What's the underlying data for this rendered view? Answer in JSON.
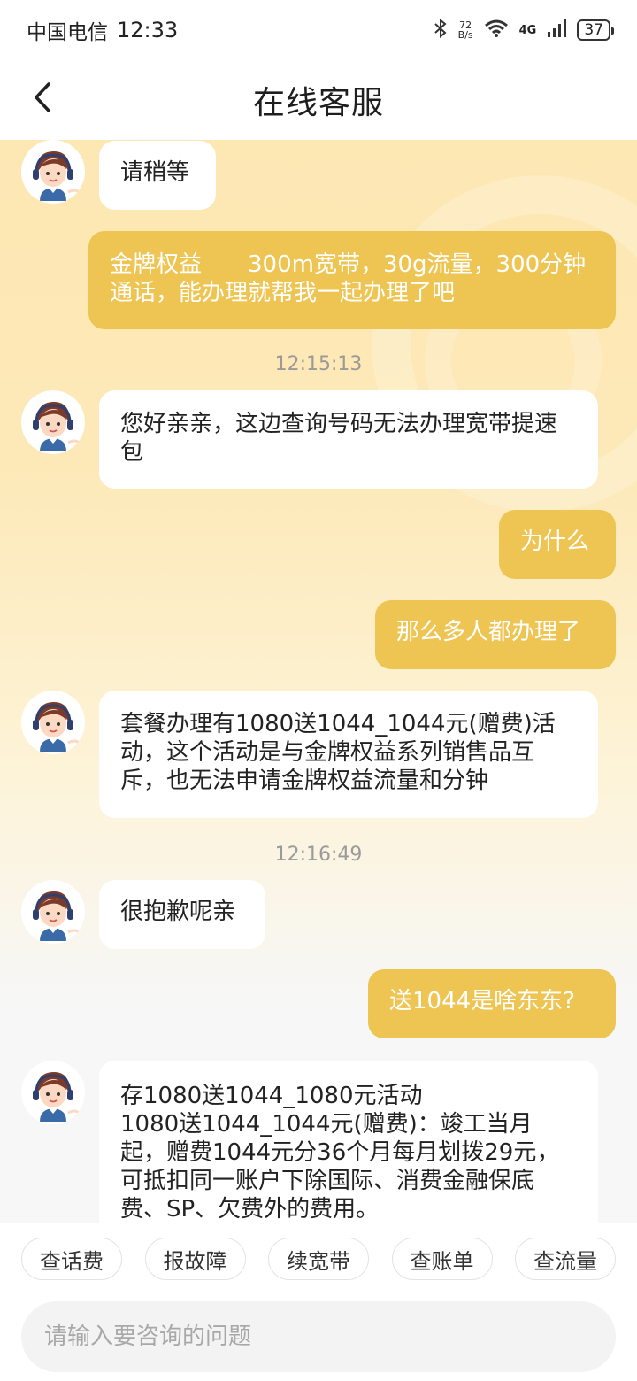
{
  "status_bar": {
    "carrier": "中国电信",
    "time": "12:33",
    "net_speed_value": "72",
    "net_speed_unit": "B/s",
    "network": "4G",
    "battery": "37"
  },
  "header": {
    "title": "在线客服"
  },
  "messages": [
    {
      "role": "agent",
      "text": "请稍等"
    },
    {
      "role": "user",
      "text": "金牌权益　　300m宽带，30g流量，300分钟通话，能办理就帮我一起办理了吧"
    },
    {
      "role": "time",
      "text": "12:15:13"
    },
    {
      "role": "agent",
      "text": "您好亲亲，这边查询号码无法办理宽带提速包"
    },
    {
      "role": "user",
      "text": "为什么"
    },
    {
      "role": "user",
      "text": "那么多人都办理了"
    },
    {
      "role": "agent",
      "text": "套餐办理有1080送1044_1044元(赠费)活动，这个活动是与金牌权益系列销售品互斥，也无法申请金牌权益流量和分钟"
    },
    {
      "role": "time",
      "text": "12:16:49"
    },
    {
      "role": "agent",
      "text": "很抱歉呢亲"
    },
    {
      "role": "user",
      "text": "送1044是啥东东?"
    },
    {
      "role": "agent",
      "text": "存1080送1044_1080元活动\n1080送1044_1044元(赠费)：竣工当月起，赠费1044元分36个月每月划拨29元，可抵扣同一账户下除国际、消费金融保底费、SP、欠费外的费用。"
    }
  ],
  "quick_actions": [
    "查话费",
    "报故障",
    "续宽带",
    "查账单",
    "查流量"
  ],
  "input": {
    "placeholder": "请输入要咨询的问题",
    "value": ""
  },
  "colors": {
    "user_bubble": "#eec453",
    "agent_bubble": "#ffffff",
    "chat_bg_top": "#fde7b3",
    "chat_bg_bottom": "#f7f7f7"
  },
  "icons": {
    "back": "chevron-left-icon",
    "avatar": "support-agent-avatar"
  }
}
